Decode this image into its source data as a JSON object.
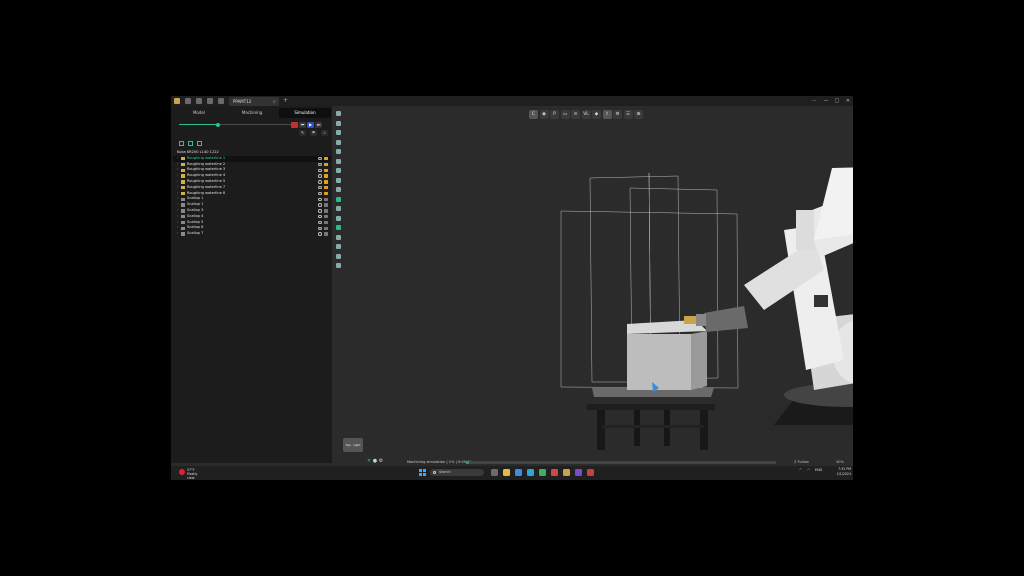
{
  "window": {
    "tab_title": "PPAMT12",
    "tab_close": "×",
    "tab_add": "+",
    "controls": {
      "more": "···",
      "minimize": "—",
      "maximize": "□",
      "close": "✕"
    }
  },
  "panel": {
    "tabs": [
      {
        "label": "Model",
        "active": false
      },
      {
        "label": "Machining",
        "active": false
      },
      {
        "label": "Simulation",
        "active": true
      }
    ],
    "simulation_progress_fraction": 0.35,
    "controls": {
      "prev": "⏮",
      "play": "▶",
      "next": "⏭"
    },
    "tree": {
      "root": "Kuka KR200 L140 1222",
      "items": [
        {
          "label": "Roughing waterline 1",
          "type": "roughing",
          "active": true
        },
        {
          "label": "Roughing waterline 2",
          "type": "roughing",
          "active": false
        },
        {
          "label": "Roughing waterline 3",
          "type": "roughing",
          "active": false
        },
        {
          "label": "Roughing waterline 4",
          "type": "roughing",
          "active": false
        },
        {
          "label": "Roughing waterline 5",
          "type": "roughing",
          "active": false
        },
        {
          "label": "Roughing waterline 7",
          "type": "roughing",
          "active": false
        },
        {
          "label": "Roughing waterline 8",
          "type": "roughing",
          "active": false
        },
        {
          "label": "Scallop 1",
          "type": "scallop",
          "active": false
        },
        {
          "label": "Scallop 1",
          "type": "scallop",
          "active": false
        },
        {
          "label": "Scallop 3",
          "type": "scallop",
          "active": false
        },
        {
          "label": "Scallop 4",
          "type": "scallop",
          "active": false
        },
        {
          "label": "Scallop 5",
          "type": "scallop",
          "active": false
        },
        {
          "label": "Scallop 6",
          "type": "scallop",
          "active": false
        },
        {
          "label": "Scallop 7",
          "type": "scallop",
          "active": false
        }
      ]
    }
  },
  "top_toolbar": [
    "C",
    "◉",
    "P",
    "▭",
    "≡",
    "VL",
    "◆",
    "⇧",
    "⚙",
    "☰",
    "⊞"
  ],
  "status": {
    "text": "Machining simulation | 1% | 0:00:01",
    "progress_fraction": 0.01,
    "right_label": "Z Follow",
    "zoom": "40%"
  },
  "nav_cube": "Top · right",
  "taskbar": {
    "weather_temp": "57°F",
    "weather_desc": "Mostly clear",
    "search_placeholder": "Search",
    "tray": "ENG",
    "time": "7:32 PM",
    "date": "2/1/2024"
  },
  "colors": {
    "accent": "#30c08f",
    "active_label": "#35d39b",
    "background": "#2b2b2b"
  }
}
